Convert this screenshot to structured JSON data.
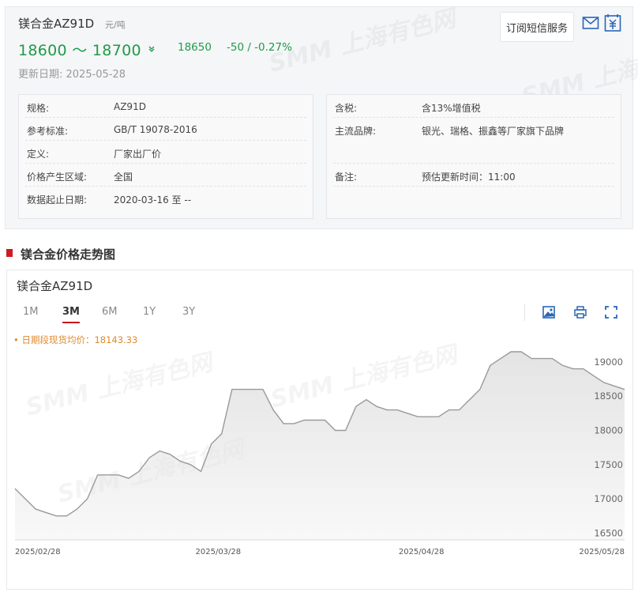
{
  "product": {
    "name": "镁合金AZ91D",
    "unit": "元/吨",
    "price_range": "18600 ～ 18700",
    "avg": "18650",
    "change": "-50 / -0.27%",
    "update_date": "更新日期: 2025-05-28",
    "subscribe_label": "订阅短信服务",
    "trend_icon": "double-chevron-down-icon",
    "colors": {
      "down": "#1e9b48",
      "accent": "#c8161d",
      "avg_note": "#e08a2e"
    }
  },
  "specs_left": [
    {
      "key": "规格:",
      "value": "AZ91D"
    },
    {
      "key": "参考标准:",
      "value": "GB/T 19078-2016"
    },
    {
      "key": "定义:",
      "value": "厂家出厂价"
    },
    {
      "key": "价格产生区域:",
      "value": "全国"
    },
    {
      "key": "数据起止日期:",
      "value": "2020-03-16 至 --"
    }
  ],
  "specs_right": [
    {
      "key": "含税:",
      "value": "含13%增值税"
    },
    {
      "key": "主流品牌:",
      "value": "银光、瑞格、振鑫等厂家旗下品牌"
    },
    {
      "key": "备注:",
      "value": "预估更新时间：11:00"
    }
  ],
  "section_title": "镁合金价格走势图",
  "chart_panel": {
    "title": "镁合金AZ91D",
    "tabs": [
      {
        "label": "1M",
        "active": false
      },
      {
        "label": "3M",
        "active": true
      },
      {
        "label": "6M",
        "active": false
      },
      {
        "label": "1Y",
        "active": false
      },
      {
        "label": "3Y",
        "active": false
      }
    ],
    "avg_note": "• 日期段现货均价：18143.33",
    "watermark": "SMM 上海有色网"
  },
  "chart_data": {
    "type": "area",
    "title": "",
    "xlabel": "",
    "ylabel": "",
    "x_ticks": [
      "2025/02/28",
      "2025/03/28",
      "2025/04/28",
      "2025/05/28"
    ],
    "y_ticks": [
      16500,
      17000,
      17500,
      18000,
      18500,
      19000
    ],
    "ylim": [
      16400,
      19300
    ],
    "grid": false,
    "y_axis_side": "right",
    "line_color": "#999999",
    "fill_color": "#e4e4e4",
    "series": [
      {
        "values": [
          17150,
          17000,
          16850,
          16800,
          16750,
          16750,
          16850,
          17000,
          17350,
          17350,
          17350,
          17300,
          17400,
          17600,
          17700,
          17650,
          17550,
          17500,
          17400,
          17800,
          17950,
          18600,
          18600,
          18600,
          18600,
          18300,
          18100,
          18100,
          18150,
          18150,
          18150,
          18000,
          18000,
          18350,
          18450,
          18350,
          18300,
          18300,
          18250,
          18200,
          18200,
          18200,
          18300,
          18300,
          18450,
          18600,
          18950,
          19050,
          19150,
          19150,
          19050,
          19050,
          19050,
          18950,
          18900,
          18900,
          18800,
          18700,
          18650,
          18600
        ]
      }
    ]
  }
}
